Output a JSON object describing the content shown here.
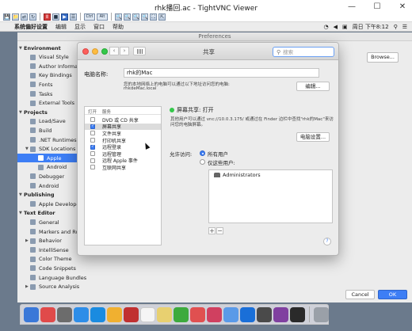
{
  "vnc": {
    "title": "rhk播回.ac - TightVNC Viewer",
    "min": "—",
    "max": "☐",
    "close": "✕",
    "toolbar": [
      "💾",
      "📁",
      "⇄",
      "↻",
      "Ⅱ",
      "■",
      "▶",
      "☰",
      "Ctrl",
      "Alt",
      "🔍",
      "🔍",
      "🔍",
      "🔍",
      "⛶",
      "⇱"
    ]
  },
  "mac_menu": {
    "apple": "",
    "items": [
      "系统偏好设置",
      "编辑",
      "显示",
      "窗口",
      "帮助"
    ],
    "time": "周日 下午8:12"
  },
  "prefs": {
    "title": "Preferences",
    "browse": "Browse...",
    "cancel": "Cancel",
    "ok": "OK",
    "sidebar": [
      {
        "label": "Environment",
        "head": true
      },
      {
        "label": "Visual Style"
      },
      {
        "label": "Author Information"
      },
      {
        "label": "Key Bindings"
      },
      {
        "label": "Fonts"
      },
      {
        "label": "Tasks"
      },
      {
        "label": "External Tools"
      },
      {
        "label": "Projects",
        "head": true
      },
      {
        "label": "Load/Save"
      },
      {
        "label": "Build"
      },
      {
        "label": ".NET Runtimes"
      },
      {
        "label": "SDK Locations"
      },
      {
        "label": "Apple"
      },
      {
        "label": "Android"
      },
      {
        "label": "Debugger"
      },
      {
        "label": "Android"
      },
      {
        "label": "Publishing",
        "head": true
      },
      {
        "label": "Apple Developer"
      },
      {
        "label": "Text Editor",
        "head": true
      },
      {
        "label": "General"
      },
      {
        "label": "Markers and Rulers"
      },
      {
        "label": "Behavior"
      },
      {
        "label": "IntelliSense"
      },
      {
        "label": "Color Theme"
      },
      {
        "label": "Code Snippets"
      },
      {
        "label": "Language Bundles"
      },
      {
        "label": "Source Analysis"
      }
    ]
  },
  "share": {
    "title": "共享",
    "search_placeholder": "搜索",
    "name_label": "电脑名称:",
    "name_value": "rhk的Mac",
    "name_desc1": "您的本地网络上的电脑可以通过以下地址访问您的电脑:",
    "name_desc2": "rhkdeMac.local",
    "edit_btn": "编辑...",
    "col_on": "打开",
    "col_service": "服务",
    "services": [
      {
        "label": "DVD 或 CD 共享",
        "on": false
      },
      {
        "label": "屏幕共享",
        "on": true
      },
      {
        "label": "文件共享",
        "on": false
      },
      {
        "label": "打印机共享",
        "on": false
      },
      {
        "label": "远程登录",
        "on": true
      },
      {
        "label": "远程管理",
        "on": false
      },
      {
        "label": "远程 Apple 事件",
        "on": false
      },
      {
        "label": "互联网共享",
        "on": false
      }
    ],
    "status": "屏幕共享: 打开",
    "status_desc1": "其他用户可以通过 vnc://10.0.3.175/ 或通过在 Finder 边栏中查找\"rhk的Mac\"来访",
    "status_desc2": "问您的电脑屏幕。",
    "computer_settings": "电脑设置...",
    "allow_label": "允许访问:",
    "opt_all": "所有用户",
    "opt_only": "仅这些用户:",
    "users": [
      "Administrators"
    ],
    "add": "+",
    "remove": "−",
    "help": "?"
  },
  "dock": {
    "colors": [
      "#3a78d8",
      "#e04a4a",
      "#6c6c6c",
      "#2d8de8",
      "#1a8be0",
      "#f0b030",
      "#c03030",
      "#f5f5f5",
      "#e8d070",
      "#3daa3d",
      "#e05050",
      "#d04060",
      "#5a9ae8",
      "#1a6fd8",
      "#4a4a4a",
      "#8040a0",
      "#2a2a2a",
      "#9aa0a8"
    ]
  }
}
